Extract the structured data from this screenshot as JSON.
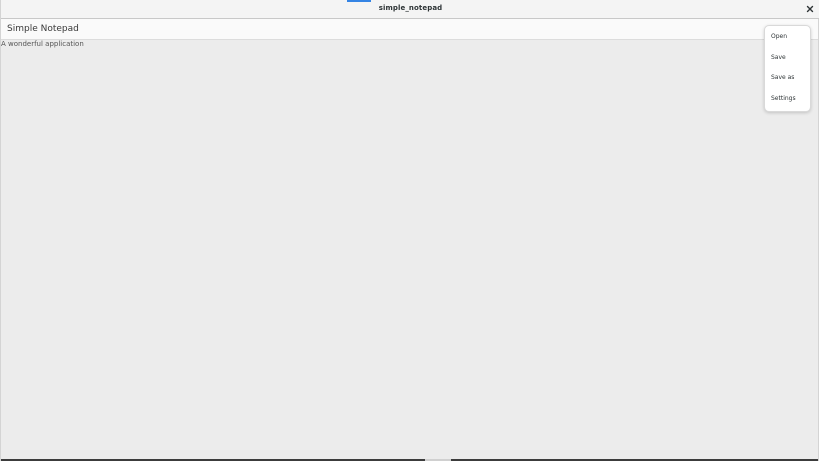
{
  "window": {
    "title": "simple_notepad",
    "close_symbol": "×"
  },
  "app": {
    "title": "Simple Notepad",
    "subtitle": "A wonderful application"
  },
  "menu": {
    "items": [
      {
        "label": "Open"
      },
      {
        "label": "Save"
      },
      {
        "label": "Save as"
      },
      {
        "label": "Settings"
      }
    ]
  },
  "colors": {
    "background": "#ececec",
    "accent": "#3584e4",
    "menu_bg": "#ffffff"
  }
}
